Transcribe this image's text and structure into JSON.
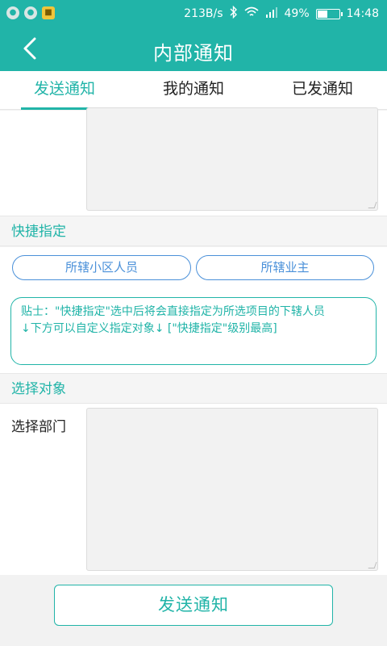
{
  "status_bar": {
    "net_speed": "213B/s",
    "battery_percent": "49%",
    "battery_level": 0.49,
    "time": "14:48",
    "icons": [
      "notification-icon",
      "notification-icon",
      "app-notification-icon",
      "bluetooth-icon",
      "wifi-icon",
      "signal-icon",
      "battery-icon"
    ]
  },
  "header": {
    "title": "内部通知",
    "back_icon": "chevron-left-icon"
  },
  "tabs": [
    {
      "label": "发送通知",
      "active": true
    },
    {
      "label": "我的通知",
      "active": false
    },
    {
      "label": "已发通知",
      "active": false
    }
  ],
  "quick_assign": {
    "title": "快捷指定",
    "options": [
      "所辖小区人员",
      "所辖业主"
    ]
  },
  "tip": {
    "line1": "贴士：\"快捷指定\"选中后将会直接指定为所选项目的下辖人员",
    "line2": "↓下方可以自定义指定对象↓ [\"快捷指定\"级别最高]"
  },
  "select_target": {
    "title": "选择对象",
    "department_label": "选择部门"
  },
  "actions": {
    "send_label": "发送通知"
  },
  "colors": {
    "primary": "#21b4a8",
    "pill_border": "#4a90d9",
    "background": "#f2f2f2"
  }
}
